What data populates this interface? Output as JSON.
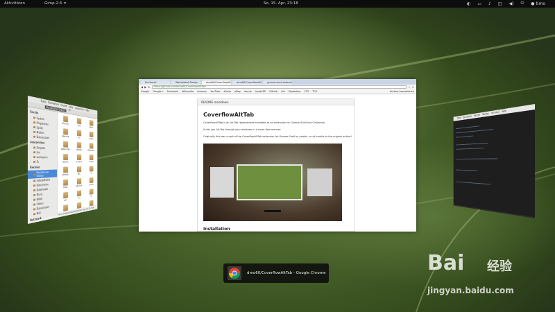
{
  "top_panel": {
    "activities": "Aktivitäten",
    "app_name": "Gimp-2.6",
    "app_arrow": "▾",
    "clock": "So, 15. Apr, 23:18",
    "user": "timo"
  },
  "left_window": {
    "menus": [
      "Datei",
      "Bearbeiten",
      "Ansicht",
      "Gehe zu",
      "Lesezeichen",
      "Hilfe"
    ],
    "path": "Persönlicher Ordner",
    "sidebar": {
      "sections": [
        {
          "title": "Geräte",
          "items": [
            "System",
            "Programme",
            "Spiele",
            "Medien",
            "Dateisystem"
          ]
        },
        {
          "title": "Lesezeichen",
          "items": [
            "Dropbox",
            "Uni",
            "workspace",
            "Tu"
          ]
        },
        {
          "title": "Rechner",
          "items": [
            "Persönlicher Ordner",
            "Arbeitsfläche",
            "Dokumente",
            "Downloads",
            "Musik",
            "Bilder",
            "Videos",
            "Dateisystem",
            "Müll"
          ]
        },
        {
          "title": "Netzwerk",
          "items": []
        }
      ],
      "selected": "Persönlicher Ordner"
    },
    "folders": [
      "GTK-Dark",
      "mpd",
      "Bilder",
      "Bilder-Alt",
      "dfs",
      "dolphin",
      "Dokumente",
      "Desktop",
      "Downloads",
      "drsprite",
      "Dropbox",
      "eclipse",
      "gitrepos",
      "gtk",
      "ilb",
      "Musik",
      "gitconfig",
      "scripts",
      "pub",
      "Uni",
      "ws",
      "Vorlagen",
      "work",
      "xfce"
    ],
    "status": "»Tu« (Ordner) ausgewählt, freier Speicher: 38,5 GB"
  },
  "right_window": {
    "menus": [
      "Datei",
      "Bearbeiten",
      "Ansicht",
      "Suchen",
      "Terminal",
      "Hilfe"
    ]
  },
  "chrome_window": {
    "tabs": [
      "Rundmail",
      "Wahlplakat Design",
      "dmo60/CoverflowAltTab",
      "dmo60/CoverflowAltTab",
      "gnome-shell-extensions"
    ],
    "active_tab": 2,
    "url": "https://github.com/dmo60/CoverflowAltTab",
    "bookmarks": [
      "Google",
      "Google+",
      "Facebook",
      "Wikipedia",
      "Amazon",
      "YouTube",
      "Kicker",
      "eBay",
      "leo.de",
      "InstaAPP",
      "GitHub",
      "Uni",
      "Mydosbox",
      "CTS",
      "TCH"
    ],
    "other_bookmarks": "Andere Lesezeichen",
    "readme_file": "README.markdown",
    "readme_title": "CoverflowAltTab",
    "readme_p1": "CoverflowAltTab is an Alt-Tab replacement available as an extension for Gnome-Shell and Cinnamon.",
    "readme_p2": "It lets you Alt-Tab through your windows in a cover-flow manner.",
    "readme_p3": "Originally this was a port of the CoverflowAltTab extension for Gnome-Shell by palatis, so all credits to the original author!",
    "section2": "Installation"
  },
  "switcher": {
    "label": "dmo60/CoverflowAltTab - Google Chrome"
  },
  "watermark": {
    "brand": "Bai",
    "brand2": "经验",
    "url": "jingyan.baidu.com"
  },
  "colors": {
    "panel_bg": "#0d0d0d",
    "desktop_green": "#4a6a2c",
    "selection_blue": "#4a88d8"
  }
}
